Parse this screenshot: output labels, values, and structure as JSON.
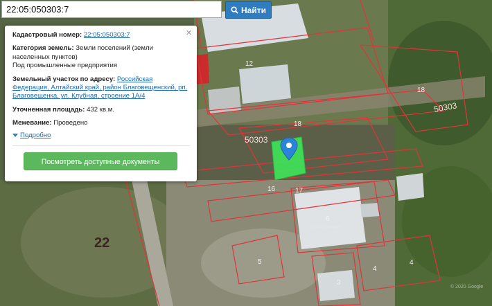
{
  "search": {
    "value": "22:05:050303:7",
    "button_label": "Найти"
  },
  "popup": {
    "cadastral_label": "Кадастровый номер:",
    "cadastral_number": "22:05:050303:7",
    "category_label": "Категория земель:",
    "category_value": "Земли поселений (земли населенных пунктов)",
    "category_use": "Под промышленные предприятия",
    "address_label": "Земельный участок по адресу:",
    "address_value": "Российская Федерация, Алтайский край, район Благовещенский, рп. Благовещенка, ул. Клубная, строение 1А/4",
    "area_label": "Уточненная площадь:",
    "area_value": "432 кв.м.",
    "survey_label": "Межевание:",
    "survey_value": "Проведено",
    "more_label": "Подробно",
    "docs_button": "Посмотреть доступные документы",
    "close_symbol": "×"
  },
  "map": {
    "labels": {
      "q12": "12",
      "q18a": "18",
      "q18b": "18",
      "q50303a": "50303",
      "q50303b": "50303",
      "q16": "16",
      "q17": "17",
      "q6": "6",
      "q22": "22",
      "q5": "5",
      "q4a": "4",
      "q4b": "4",
      "q3": "3",
      "watermark1": "© 2020 Google",
      "watermark2": "© 2020 Google"
    },
    "colors": {
      "parcel_border": "#e0343a",
      "selected_parcel": "#3ee65a",
      "marker": "#2b84d8"
    }
  }
}
